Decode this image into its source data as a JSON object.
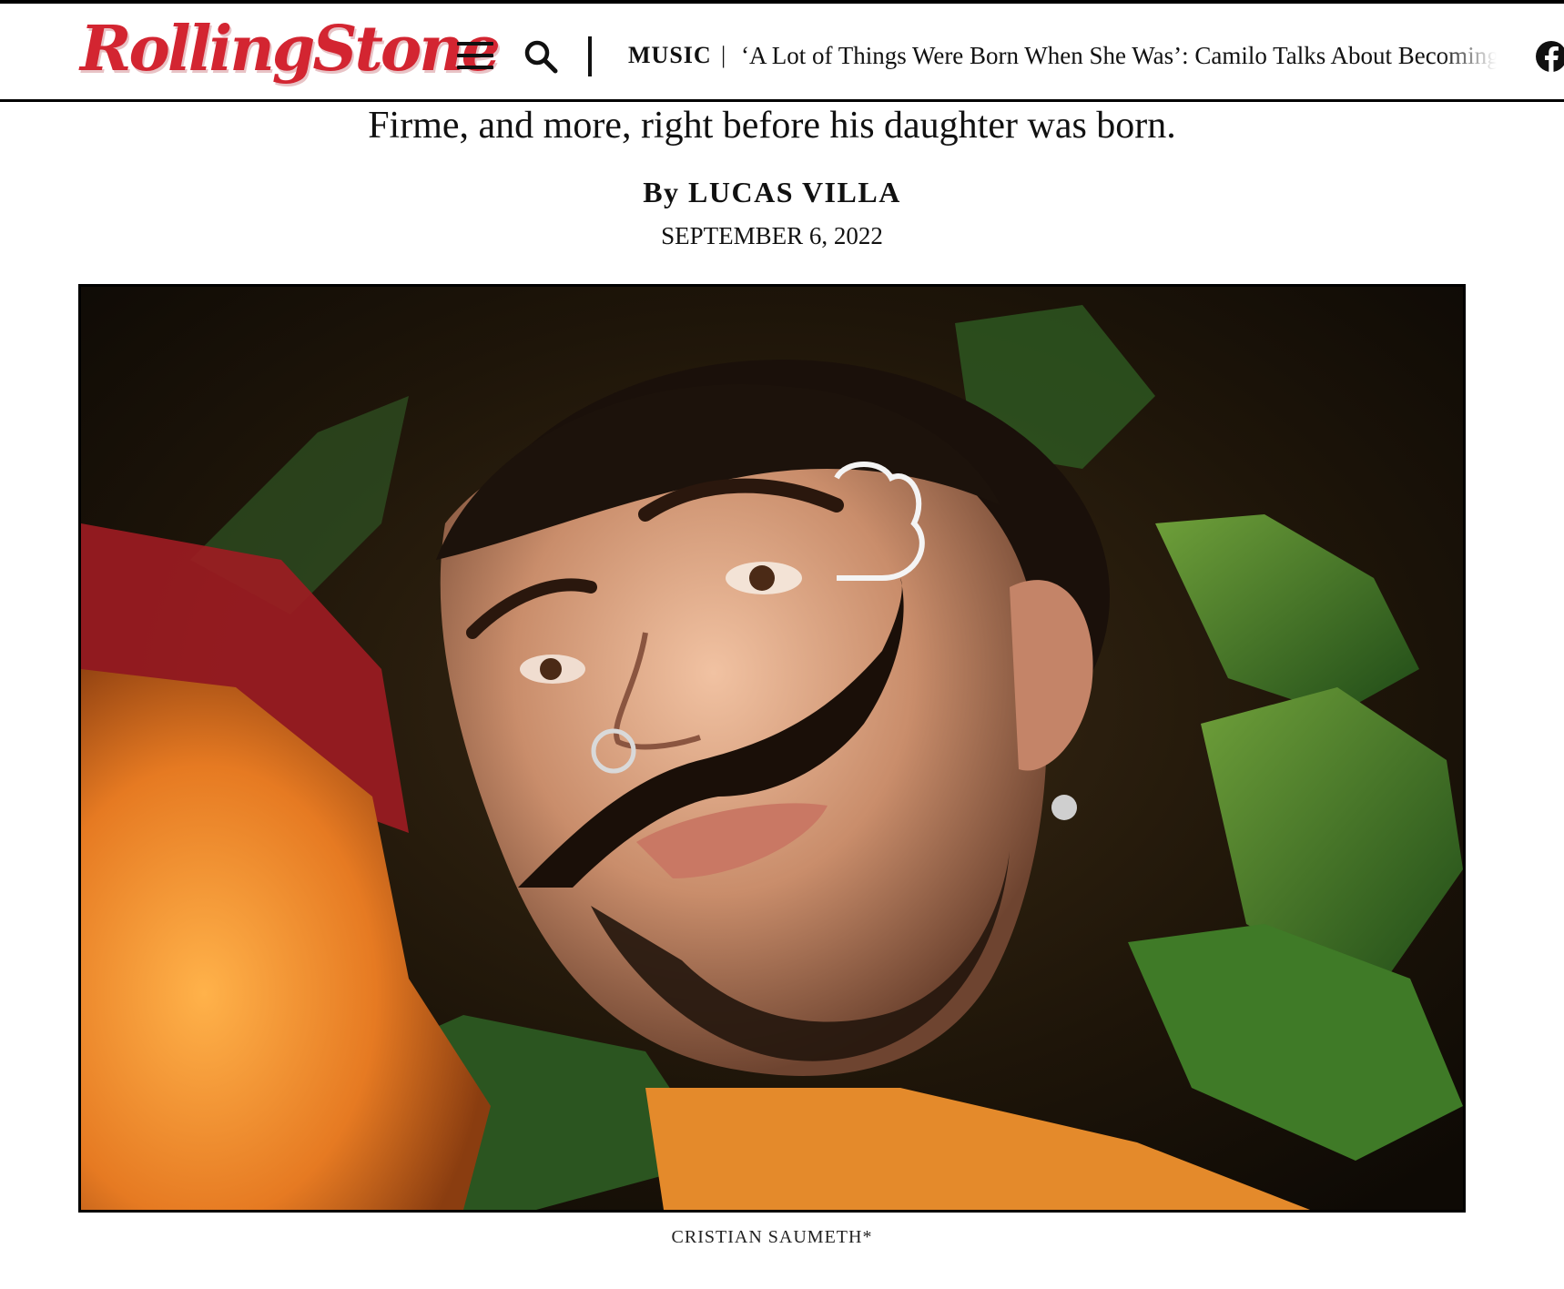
{
  "header": {
    "logo_text": "RollingStone",
    "section": "MUSIC",
    "separator": "|",
    "headline": "‘A Lot of Things Were Born When She Was’: Camilo Talks About Becoming a Father"
  },
  "article": {
    "dek": "Firme, and more, right before his daughter was born.",
    "byline_prefix": "By",
    "author": "LUCAS VILLA",
    "date": "SEPTEMBER 6, 2022"
  },
  "photo": {
    "caption": "CRISTIAN SAUMETH*"
  },
  "colors": {
    "brand_red": "#d32531",
    "text": "#111111",
    "border": "#000000"
  },
  "icons": {
    "menu": "hamburger-menu-icon",
    "search": "search-icon",
    "social": "facebook-icon"
  }
}
